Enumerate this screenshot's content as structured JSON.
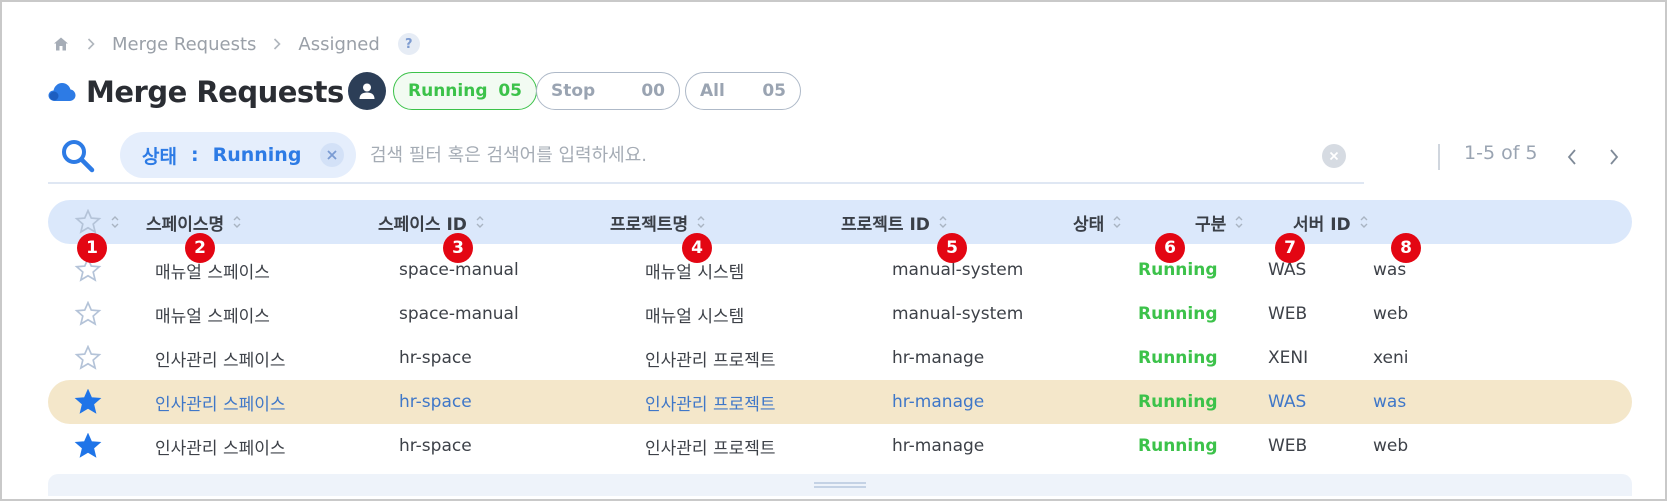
{
  "breadcrumb": {
    "items": [
      "Merge Requests",
      "Assigned"
    ],
    "help": "?"
  },
  "header": {
    "title": "Merge Requests"
  },
  "status_pills": [
    {
      "label": "Running",
      "count": "05"
    },
    {
      "label": "Stop",
      "count": "00"
    },
    {
      "label": "All",
      "count": "05"
    }
  ],
  "search": {
    "filter_key": "상태",
    "filter_sep": ":",
    "filter_value": "Running",
    "placeholder": "검색 필터 혹은 검색어를 입력하세요."
  },
  "pager": {
    "text": "1-5 of 5"
  },
  "table": {
    "columns": [
      "스페이스명",
      "스페이스 ID",
      "프로젝트명",
      "프로젝트 ID",
      "상태",
      "구분",
      "서버 ID"
    ],
    "rows": [
      {
        "starred": false,
        "space_name": "매뉴얼 스페이스",
        "space_id": "space-manual",
        "project_name": "매뉴얼 시스템",
        "project_id": "manual-system",
        "status": "Running",
        "type": "WAS",
        "server_id": "was"
      },
      {
        "starred": false,
        "space_name": "매뉴얼 스페이스",
        "space_id": "space-manual",
        "project_name": "매뉴얼 시스템",
        "project_id": "manual-system",
        "status": "Running",
        "type": "WEB",
        "server_id": "web"
      },
      {
        "starred": false,
        "space_name": "인사관리 스페이스",
        "space_id": "hr-space",
        "project_name": "인사관리 프로젝트",
        "project_id": "hr-manage",
        "status": "Running",
        "type": "XENI",
        "server_id": "xeni"
      },
      {
        "starred": true,
        "highlighted": true,
        "space_name": "인사관리 스페이스",
        "space_id": "hr-space",
        "project_name": "인사관리 프로젝트",
        "project_id": "hr-manage",
        "status": "Running",
        "type": "WAS",
        "server_id": "was"
      },
      {
        "starred": true,
        "space_name": "인사관리 스페이스",
        "space_id": "hr-space",
        "project_name": "인사관리 프로젝트",
        "project_id": "hr-manage",
        "status": "Running",
        "type": "WEB",
        "server_id": "web"
      }
    ]
  },
  "callouts": [
    "1",
    "2",
    "3",
    "4",
    "5",
    "6",
    "7",
    "8"
  ],
  "colors": {
    "accent_blue": "#2d7be5",
    "running_green": "#3cc24a",
    "callout_red": "#e30613",
    "header_bg": "#dbe8fb",
    "highlight_row": "#f4e7ca"
  },
  "icons": {
    "home": "home-icon",
    "search": "search-icon",
    "user": "user-icon",
    "star": "star-icon",
    "cloud": "cloud-icon"
  }
}
